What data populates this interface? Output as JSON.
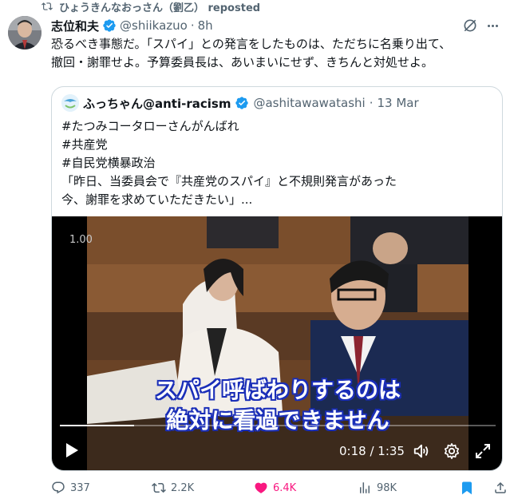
{
  "repost": {
    "text": "ひょうきんなおっさん（劉乙） reposted"
  },
  "post": {
    "author_name": "志位和夫",
    "handle": "@shiikazuo",
    "separator": "·",
    "time": "8h",
    "text": "恐るべき事態だ。「スパイ」との発言をしたものは、ただちに名乗り出て、\n撤回・謝罪せよ。予算委員長は、あいまいにせず、きちんと対処せよ。"
  },
  "quote": {
    "author_name": "ふっちゃん@anti-racism",
    "handle": "@ashitawawatashi",
    "separator": "·",
    "date": "13 Mar",
    "lines": [
      "#たつみコータローさんがんばれ",
      "#共産党",
      "#自民党横暴政治",
      "「昨日、当委員会で『共産党のスパイ』と不規則発言があった",
      "今、謝罪を求めていただきたい」..."
    ]
  },
  "video": {
    "badge": "1.00",
    "subtitle_line1": "スパイ呼ばわりするのは",
    "subtitle_line2": "絶対に看過できません",
    "time": "0:18 / 1:35",
    "progress": 0.17
  },
  "actions": {
    "replies": "337",
    "reposts": "2.2K",
    "likes": "6.4K",
    "views": "98K"
  },
  "colors": {
    "accent_blue": "#1d9bf0",
    "like_pink": "#f91880",
    "muted": "#536471",
    "subtitle_outline": "#1a2eb8"
  },
  "icons": [
    "repost-icon",
    "verified-badge-icon",
    "grok-icon",
    "more-icon",
    "play-icon",
    "volume-icon",
    "gear-icon",
    "fullscreen-icon",
    "reply-icon",
    "like-icon",
    "views-icon",
    "bookmark-icon",
    "share-icon"
  ]
}
